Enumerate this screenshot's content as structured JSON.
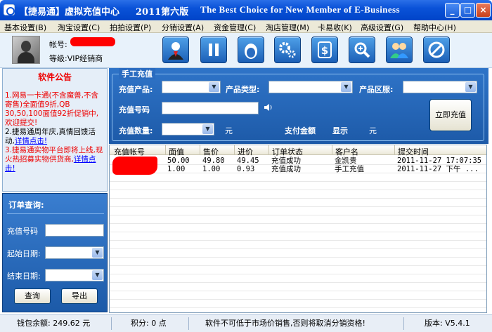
{
  "window": {
    "title_main": "【捷易通】虚拟充值中心",
    "title_version": "2011第六版",
    "title_slogan": "The Best Choice for New Member of E-Business",
    "btn_min": "_",
    "btn_max": "□",
    "btn_close": "×"
  },
  "menu": [
    "基本设置(B)",
    "淘宝设置(C)",
    "拍拍设置(P)",
    "分销设置(A)",
    "资金管理(C)",
    "淘店管理(M)",
    "卡易收(K)",
    "高级设置(G)",
    "帮助中心(H)"
  ],
  "user": {
    "account_label": "帐号:",
    "level_label": "等级:",
    "level_value": "VIP经销商"
  },
  "toolbar_icons": [
    "user-agent-icon",
    "pause-icon",
    "qq-penguin-icon",
    "settings-gears-icon",
    "dollar-icon",
    "search-zoom-icon",
    "users-group-icon",
    "cancel-icon"
  ],
  "notice": {
    "title": "软件公告",
    "line1": "1.网易一卡通(不含魔兽,不含寄售)全面值9折,QB 30,50,100面值92折促销中,欢迎提交!",
    "line2_a": "2.捷易通周年庆,真情回馈活动,",
    "line2_link": "详情点击!",
    "line3_a": "3.捷易通实物平台即将上线,现火热招募实物供货商,",
    "line3_link": "详情点击!"
  },
  "query": {
    "title": "订单查询:",
    "order_no_label": "充值号码",
    "start_date_label": "起始日期:",
    "end_date_label": "结束日期:",
    "search_btn": "查询",
    "export_btn": "导出"
  },
  "manual": {
    "legend": "手工充值",
    "product_label": "充值产品:",
    "type_label": "产品类型:",
    "region_label": "产品区服:",
    "number_label": "充值号码",
    "qty_label": "充值数量:",
    "unit": "元",
    "pay_label": "支付金额",
    "pay_value": "显示",
    "pay_unit": "元",
    "charge_btn": "立即充值"
  },
  "table": {
    "columns": [
      "充值帐号",
      "面值",
      "售价",
      "进价",
      "订单状态",
      "客户名",
      "提交时间"
    ],
    "rows": [
      [
        "",
        "50.00",
        "49.80",
        "49.45",
        "充值成功",
        "金凯贵",
        "2011-11-27 17:07:35"
      ],
      [
        "",
        "1.00",
        "1.00",
        "0.93",
        "充值成功",
        "手工充值",
        "2011-11-27 下午 ..."
      ]
    ]
  },
  "status": {
    "balance": "钱包余额: 249.62 元",
    "points": "积分: 0 点",
    "warning": "软件不可低于市场价销售,否则将取消分销资格!",
    "version": "版本: V5.4.1"
  },
  "colors": {
    "titlebar": "#0a52d8",
    "panel_blue": "#1d5aa8",
    "notice_red": "#e00000",
    "link_blue": "#0000ff"
  }
}
